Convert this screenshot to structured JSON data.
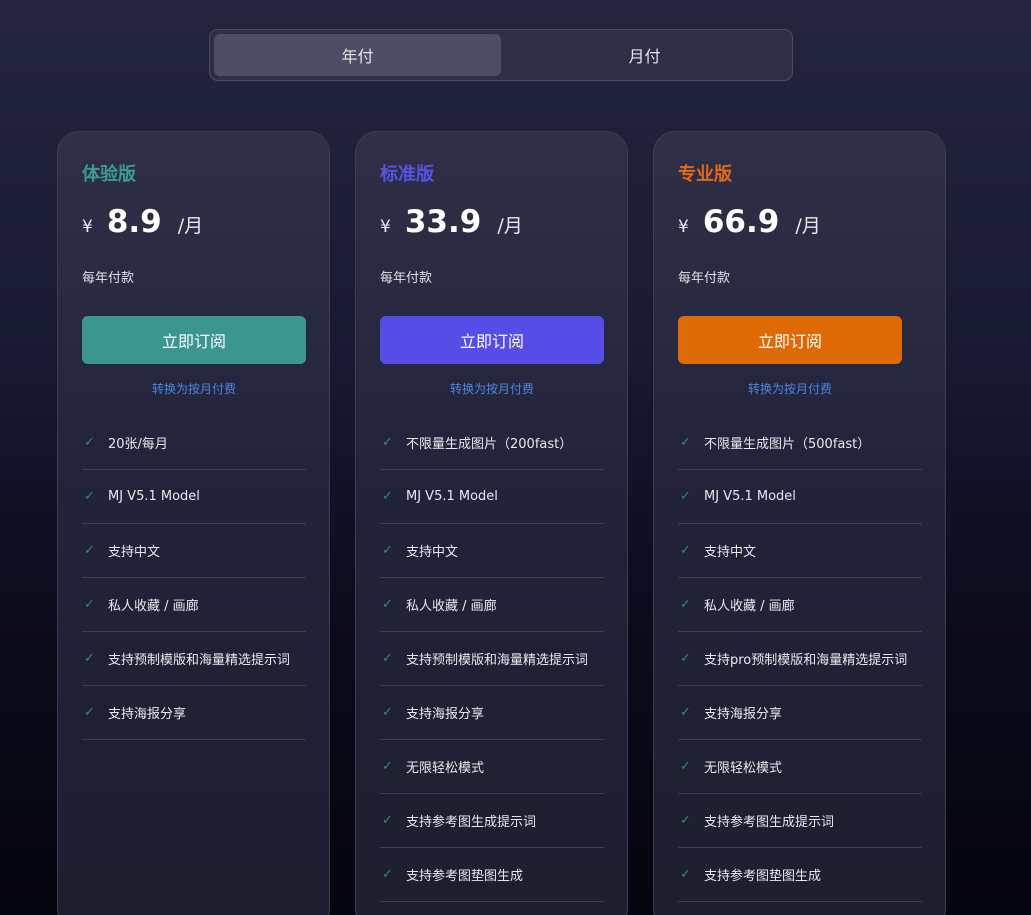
{
  "billing_toggle": {
    "options": [
      {
        "label": "年付",
        "active": true
      },
      {
        "label": "月付",
        "active": false
      }
    ]
  },
  "plans": [
    {
      "name": "体验版",
      "name_color": "#3c9a8e",
      "currency": "¥",
      "price": "8.9",
      "period": "/月",
      "billing_note": "每年付款",
      "subscribe_label": "立即订阅",
      "button_color": "#3c9690",
      "switch_link": "转换为按月付费",
      "check_icon": "check-icon",
      "features": [
        "20张/每月",
        "MJ V5.1 Model",
        "支持中文",
        "私人收藏 / 画廊",
        "支持预制模版和海量精选提示词",
        "支持海报分享"
      ]
    },
    {
      "name": "标准版",
      "name_color": "#5a52e6",
      "currency": "¥",
      "price": "33.9",
      "period": "/月",
      "billing_note": "每年付款",
      "subscribe_label": "立即订阅",
      "button_color": "#554de6",
      "switch_link": "转换为按月付费",
      "check_icon": "check-icon",
      "features": [
        "不限量生成图片（200fast）",
        "MJ V5.1 Model",
        "支持中文",
        "私人收藏 / 画廊",
        "支持预制模版和海量精选提示词",
        "支持海报分享",
        "无限轻松模式",
        "支持参考图生成提示词",
        "支持参考图垫图生成"
      ]
    },
    {
      "name": "专业版",
      "name_color": "#e36a14",
      "currency": "¥",
      "price": "66.9",
      "period": "/月",
      "billing_note": "每年付款",
      "subscribe_label": "立即订阅",
      "button_color": "#de6a06",
      "switch_link": "转换为按月付费",
      "check_icon": "check-icon",
      "features": [
        "不限量生成图片（500fast）",
        "MJ V5.1 Model",
        "支持中文",
        "私人收藏 / 画廊",
        "支持pro预制模版和海量精选提示词",
        "支持海报分享",
        "无限轻松模式",
        "支持参考图生成提示词",
        "支持参考图垫图生成"
      ]
    }
  ]
}
